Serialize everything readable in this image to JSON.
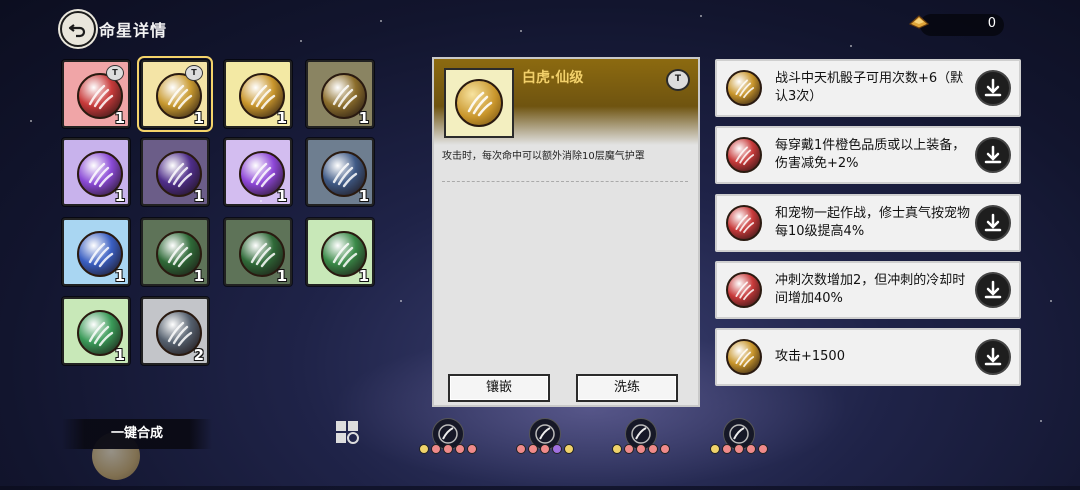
{
  "header": {
    "title": "命星详情",
    "currency_value": "0"
  },
  "colors": {
    "pink": "#f2a6a6",
    "gold": "#f4d36a",
    "yellow": "#f4e9a0",
    "olive": "#8a8462",
    "lavender": "#c9b2ec",
    "dark_purple": "#6b5d88",
    "slate": "#6e7e90",
    "light_blue": "#a9d6f2",
    "dark_green": "#5e7358",
    "light_green": "#c8e8b8",
    "silver": "#c3c5c9"
  },
  "grid": [
    {
      "bg": "#f0a5a7",
      "orb": "#c83a3a",
      "count": "1",
      "lock": true,
      "selected": false
    },
    {
      "bg": "#f4e4a6",
      "orb": "#c99a30",
      "count": "1",
      "lock": true,
      "selected": true
    },
    {
      "bg": "#f3e9a4",
      "orb": "#c9962c",
      "count": "1",
      "lock": false,
      "selected": false
    },
    {
      "bg": "#8a8462",
      "orb": "#8c6e2c",
      "count": "1",
      "lock": false,
      "selected": false
    },
    {
      "bg": "#c8b2ec",
      "orb": "#8a4ad6",
      "count": "1",
      "lock": false,
      "selected": false
    },
    {
      "bg": "#6b5d88",
      "orb": "#4f2e8a",
      "count": "1",
      "lock": false,
      "selected": false
    },
    {
      "bg": "#d3bdf0",
      "orb": "#8e47d8",
      "count": "1",
      "lock": false,
      "selected": false
    },
    {
      "bg": "#6e7e90",
      "orb": "#3f5a86",
      "count": "1",
      "lock": false,
      "selected": false
    },
    {
      "bg": "#a9d6f2",
      "orb": "#3a5fc2",
      "count": "1",
      "lock": false,
      "selected": false
    },
    {
      "bg": "#5e7358",
      "orb": "#2f6a38",
      "count": "1",
      "lock": false,
      "selected": false
    },
    {
      "bg": "#5e7358",
      "orb": "#2f6a38",
      "count": "1",
      "lock": false,
      "selected": false
    },
    {
      "bg": "#c8e8b8",
      "orb": "#3a8a48",
      "count": "1",
      "lock": false,
      "selected": false
    },
    {
      "bg": "#c8e8b8",
      "orb": "#3a9a58",
      "count": "1",
      "lock": false,
      "selected": false
    },
    {
      "bg": "#c3c5c9",
      "orb": "#55606e",
      "count": "2",
      "lock": false,
      "selected": false
    }
  ],
  "detail": {
    "name": "白虎·仙级",
    "description": "攻击时，每次命中可以额外消除10层魔气护罩",
    "inlay_label": "镶嵌",
    "refine_label": "洗练"
  },
  "effects": [
    {
      "text": "战斗中天机骰子可用次数+6（默认3次）",
      "orb": "#c9962c"
    },
    {
      "text": "每穿戴1件橙色品质或以上装备，伤害减免+2%",
      "orb": "#c83a3a"
    },
    {
      "text": "和宠物一起作战，修士真气按宠物每10级提高4%",
      "orb": "#c83a3a"
    },
    {
      "text": "冲刺次数增加2，但冲刺的冷却时间增加40%",
      "orb": "#c83a3a"
    },
    {
      "text": "攻击+1500",
      "orb": "#c9962c"
    }
  ],
  "bottom": {
    "merge_label": "一键合成",
    "filters": [
      {
        "icon": "grid-filter-icon",
        "dots": []
      },
      {
        "icon": "horns-filter-icon",
        "dots": [
          "#f0d36a",
          "#f08a8a",
          "#f08a8a",
          "#f08a8a",
          "#f08a8a"
        ]
      },
      {
        "icon": "moon-filter-icon",
        "dots": [
          "#f08a8a",
          "#f08a8a",
          "#f08a8a",
          "#a070e0",
          "#f0d36a"
        ]
      },
      {
        "icon": "claw-filter-icon",
        "dots": [
          "#f0d36a",
          "#f08a8a",
          "#f08a8a",
          "#f08a8a",
          "#f08a8a"
        ]
      },
      {
        "icon": "shell-filter-icon",
        "dots": [
          "#f0d36a",
          "#f08a8a",
          "#f08a8a",
          "#f08a8a",
          "#f08a8a"
        ]
      }
    ]
  }
}
